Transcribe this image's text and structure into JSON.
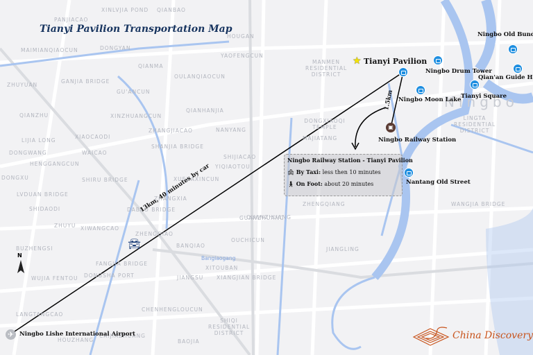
{
  "title": "Tianyi Pavilion Transportation Map",
  "compass": "N",
  "colors": {
    "title": "#17345f",
    "poi_icon": "#1e8ee0",
    "water": "#a9c5f0",
    "route": "#000000",
    "brand": "#c8531b"
  },
  "places": [
    {
      "name": "XINLVJIA POND"
    },
    {
      "name": "QIANBAO"
    },
    {
      "name": "PANJIACAO"
    },
    {
      "name": "DONGYAN"
    },
    {
      "name": "MAIMIANQIAOCUN"
    },
    {
      "name": "HOUGAN"
    },
    {
      "name": "YAOFENGCUN"
    },
    {
      "name": "QIANMA"
    },
    {
      "name": "OULANQIAOCUN"
    },
    {
      "name": "ZHUYUAN"
    },
    {
      "name": "GANJIA BRIDGE"
    },
    {
      "name": "GU'ANCUN"
    },
    {
      "name": "QIANZHU"
    },
    {
      "name": "XINZHUANGCUN"
    },
    {
      "name": "QIANHANJIA"
    },
    {
      "name": "ZHANGJIACAO"
    },
    {
      "name": "NANYANG"
    },
    {
      "name": "LIJIA LONG"
    },
    {
      "name": "XIAOCAODI"
    },
    {
      "name": "SHANJIA BRIDGE"
    },
    {
      "name": "DONGWANG"
    },
    {
      "name": "WAICAO"
    },
    {
      "name": "SHIJIACAO"
    },
    {
      "name": "HENGGANGCUN"
    },
    {
      "name": "YIQIAOTOU"
    },
    {
      "name": "DONGXU"
    },
    {
      "name": "SHIRU BRIDGE"
    },
    {
      "name": "XUEJIAXINCUN"
    },
    {
      "name": "LVDUAN BRIDGE"
    },
    {
      "name": "ZHANGXIA"
    },
    {
      "name": "SHIDAODI"
    },
    {
      "name": "DABAO BRIDGE"
    },
    {
      "name": "ZHUYU"
    },
    {
      "name": "XIWANGCAO"
    },
    {
      "name": "QUANZHUANG"
    },
    {
      "name": "BUZHENGSI"
    },
    {
      "name": "BANQIAO"
    },
    {
      "name": "OUCHICUN"
    },
    {
      "name": "XITOUBAN"
    },
    {
      "name": "FANGJIA BRIDGE"
    },
    {
      "name": "WUJIA FENTOU"
    },
    {
      "name": "DONGSHA PORT"
    },
    {
      "name": "JIANGSU"
    },
    {
      "name": "XIANGJIAN BRIDGE"
    },
    {
      "name": "CHENHENGLOUCUN"
    },
    {
      "name": "LANGTANGCAO"
    },
    {
      "name": "SHIQI RESIDENTIAL DISTRICT"
    },
    {
      "name": "CAIJIAZHUANG"
    },
    {
      "name": "HOUZHANG"
    },
    {
      "name": "BAOJIA"
    },
    {
      "name": "MANMEN RESIDENTIAL DISTRICT"
    },
    {
      "name": "DONGXIAOQI TEMPLE"
    },
    {
      "name": "MAJIATANG"
    },
    {
      "name": "LINGTA RESIDENTIAL DISTRICT"
    },
    {
      "name": "ZHENGQIAO"
    },
    {
      "name": "GUANZHUANG"
    },
    {
      "name": "ZHENGQIANG"
    },
    {
      "name": "JIANGLING"
    },
    {
      "name": "WANGJIA BRIDGE"
    },
    {
      "name": "Ningbo"
    },
    {
      "name": "Bangiaogang"
    }
  ],
  "poi": {
    "tianyi": "Tianyi Pavilion",
    "drum_tower": "Ningbo Drum Tower",
    "old_bund": "Ningbo Old Bund",
    "guild_hall": "Qian'an Guide Hall",
    "tianyi_square": "Tianyi Square",
    "moon_lake": "Ningbo Moon Lake",
    "railway": "Ningbo Railway Station",
    "nantang": "Nantang Old Street",
    "airport": "Ningbo Lishe International Airport"
  },
  "routes": {
    "airport_label": "13km, 40 minutes by car",
    "railway_label": "1.5km"
  },
  "infobox": {
    "heading": "Ningbo Railway Station - Tianyi Pavilion",
    "taxi_label": "By Taxi:",
    "taxi_value": "less then 10 minutes",
    "foot_label": "On Foot:",
    "foot_value": "about 20 minutes"
  },
  "brand": "China Discovery"
}
